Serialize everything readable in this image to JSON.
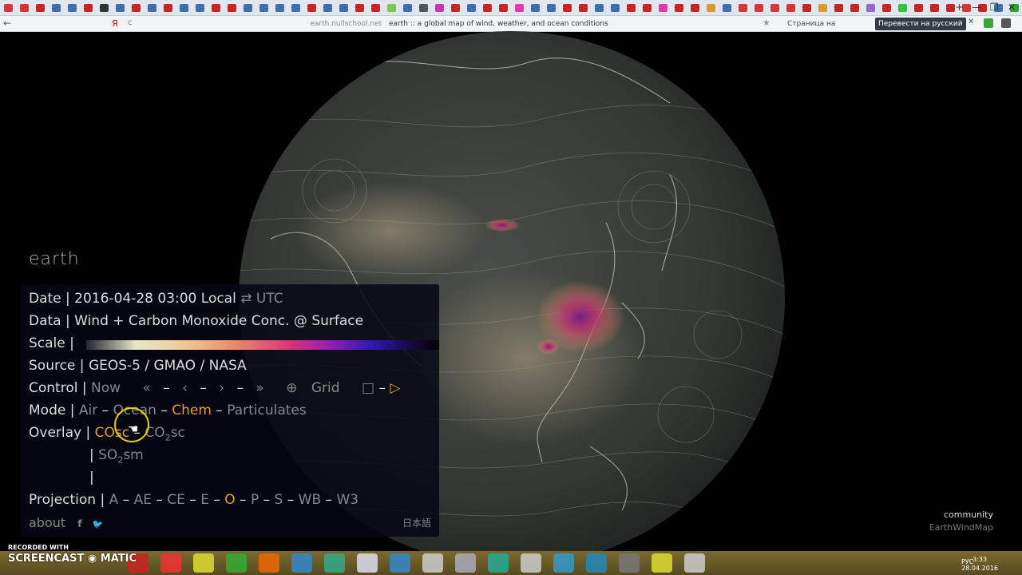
{
  "browser": {
    "tab_favicon_colors": [
      "#d33",
      "#d33",
      "#c22",
      "#3a6fb0",
      "#3a6fb0",
      "#c22",
      "#333",
      "#3a6fb0",
      "#c22",
      "#3a6fb0",
      "#c22",
      "#3a6fb0",
      "#3a6fb0",
      "#c22",
      "#c22",
      "#3a6fb0",
      "#3a6fb0",
      "#3a6fb0",
      "#3a6fb0",
      "#c22",
      "#3a6fb0",
      "#3a6fb0",
      "#c22",
      "#c22",
      "#7c4",
      "#3a6fb0",
      "#555",
      "#c3b",
      "#c22",
      "#3a6fb0",
      "#c22",
      "#c22",
      "#e3a",
      "#3a6fb0",
      "#3a6fb0",
      "#c22",
      "#c22",
      "#3a6fb0",
      "#3a6fb0",
      "#c22",
      "#c22",
      "#e3a",
      "#c22",
      "#c22",
      "#d92",
      "#3a6fb0",
      "#d33",
      "#d33",
      "#d33",
      "#d33",
      "#c22",
      "#d92",
      "#c22",
      "#c22",
      "#96c",
      "#c22",
      "#2c3",
      "#c22",
      "#c22",
      "#c22",
      "#d33",
      "#c22",
      "#3a6fb0",
      "#2a2",
      "#2a2",
      "#d92"
    ],
    "url_host": "earth.nullschool.net",
    "page_title": "earth :: a global map of wind, weather, and ocean conditions",
    "translate_prompt": "Страница на английск...",
    "translate_button": "Перевести на русский",
    "back_glyph": "←",
    "yandex_glyph": "Я",
    "reload_glyph": "c",
    "star_glyph": "★",
    "close_glyph": "✕",
    "new_tab_glyph": "+",
    "minimize_glyph": "—",
    "restore_glyph": "❐",
    "window_close_glyph": "✕"
  },
  "earth": {
    "title": "earth",
    "date": {
      "label": "Date |",
      "value": "2016-04-28 03:00 Local",
      "toggle": "⇄",
      "utc": "UTC"
    },
    "data": {
      "label": "Data |",
      "value": "Wind + Carbon Monoxide Conc. @ Surface"
    },
    "scale": {
      "label": "Scale |"
    },
    "source": {
      "label": "Source |",
      "value": "GEOS-5 / GMAO / NASA"
    },
    "control": {
      "label": "Control |",
      "now": "Now",
      "back3": "«",
      "dash1": "–",
      "back1": "‹",
      "dash2": "–",
      "fwd1": "›",
      "dash3": "–",
      "fwd3": "»",
      "locate": "⊕",
      "grid": "Grid",
      "stop": "□",
      "dash4": "–",
      "play": "▷"
    },
    "mode": {
      "label": "Mode |",
      "items": [
        "Air",
        "Ocean",
        "Chem",
        "Particulates"
      ],
      "active": "Chem"
    },
    "overlay": {
      "label": "Overlay |",
      "co": "COsc",
      "co2": "CO",
      "co2_sub": "2",
      "co2_suffix": "sc",
      "so2": "SO",
      "so2_sub": "2",
      "so2_suffix": "sm",
      "bar": "|"
    },
    "projection": {
      "label": "Projection |",
      "items": [
        "A",
        "AE",
        "CE",
        "E",
        "O",
        "P",
        "S",
        "WB",
        "W3"
      ],
      "active": "O"
    },
    "footer": {
      "about": "about",
      "facebook": "f",
      "twitter": "🐦",
      "japanese": "日本語"
    },
    "community": "community",
    "earthwindmap": "EarthWindMap"
  },
  "recorder": {
    "line1": "RECORDED WITH",
    "line2": "SCREENCAST",
    "line3": "MATIC"
  },
  "taskbar": {
    "icon_colors": [
      "#c22",
      "#e33",
      "#dd3",
      "#3a3",
      "#e60",
      "#38c",
      "#3a8",
      "#dde",
      "#38c",
      "#ccc",
      "#aab",
      "#2a9",
      "#ccc",
      "#39c",
      "#28b",
      "#777",
      "#dd3",
      "#ccc"
    ],
    "language": "РУС",
    "time": "3:33",
    "date": "28.04.2016"
  },
  "colors": {
    "accent": "#e4a031",
    "dim": "#888888",
    "text": "#dddddd"
  }
}
